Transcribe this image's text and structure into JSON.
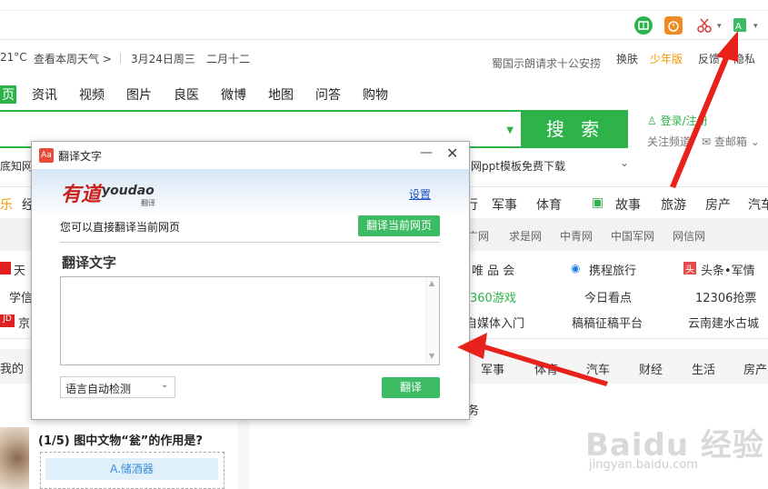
{
  "toolbar": {
    "icons": [
      "reader-icon",
      "alarm-icon",
      "scissors-icon",
      "translate-icon"
    ]
  },
  "info": {
    "temperature": "21°C",
    "weather_link": "查看本周天气 >",
    "date": "3月24日周三",
    "lunar": "二月十二",
    "notice": "蜀国示朗请求十公安捞",
    "skin": "换肤",
    "youth": "少年版",
    "feedback": "反馈",
    "privacy": "隐私"
  },
  "nav": {
    "items": [
      "页",
      "资讯",
      "视频",
      "图片",
      "良医",
      "微博",
      "地图",
      "问答",
      "购物"
    ]
  },
  "search": {
    "button_label": "搜 索",
    "login": "登录/注册",
    "follow_channel": "关注频道",
    "mailbox": "查邮箱",
    "hint_left": "底知网",
    "hint_right": "网ppt模板免费下载"
  },
  "rows": {
    "channel_tabs": [
      "乐",
      "经",
      "行",
      "军事",
      "体育",
      "故事",
      "旅游",
      "房产",
      "汽车"
    ],
    "site_links": [
      "广网",
      "求是网",
      "中青网",
      "中国军网",
      "网信网"
    ],
    "row1": [
      "天",
      "唯 品 会",
      "携程旅行",
      "头条•军情"
    ],
    "row2": [
      "学信",
      "360游戏",
      "今日看点",
      "12306抢票"
    ],
    "row3": [
      "京",
      "自媒体入门",
      "稿稿征稿平台",
      "云南建水古城"
    ],
    "news_tabs": [
      "我的",
      "军事",
      "体育",
      "汽车",
      "财经",
      "生活",
      "房产"
    ],
    "misc": "务"
  },
  "dialog": {
    "title": "翻译文字",
    "brand": "有道",
    "brand_en": "youdao",
    "brand_sub": "翻译",
    "settings": "设置",
    "direct_text": "您可以直接翻译当前网页",
    "translate_page_btn": "翻译当前网页",
    "section_title": "翻译文字",
    "textarea_value": "",
    "lang_select": "语言自动检测",
    "translate_btn": "翻译"
  },
  "quiz": {
    "question": "(1/5) 图中文物“瓮”的作用是?",
    "option_a": "A.储酒器"
  },
  "watermark": {
    "text": "Baidu 经验",
    "url": "jingyan.baidu.com"
  },
  "colors": {
    "brand_green": "#2db34a",
    "arrow_red": "#e8211b",
    "youth_orange": "#f39800",
    "dialog_green": "#3dbb64"
  }
}
